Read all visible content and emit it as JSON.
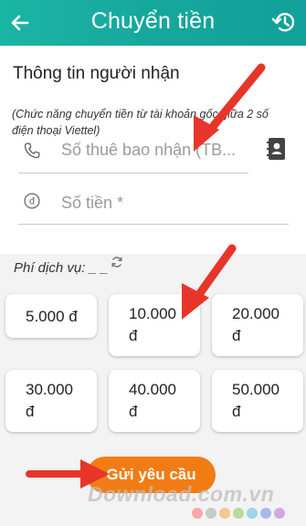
{
  "header": {
    "title": "Chuyển tiền",
    "back_icon": "arrow-left-icon",
    "history_icon": "history-icon"
  },
  "recipient": {
    "section_title": "Thông tin người nhận",
    "note": "(Chức năng chuyển tiền từ tài khoản gốc giữa 2 số điện thoại Viettel)",
    "phone_placeholder": "Số thuê bao nhận (TB...",
    "amount_placeholder": "Số tiền *"
  },
  "fee": {
    "label": "Phí dịch vụ: _ _"
  },
  "amounts": [
    {
      "value": "5.000 đ"
    },
    {
      "value": "10.000 đ"
    },
    {
      "value": "20.000 đ"
    },
    {
      "value": "30.000 đ"
    },
    {
      "value": "40.000 đ"
    },
    {
      "value": "50.000 đ"
    }
  ],
  "submit": {
    "label": "Gửi yêu cầu"
  },
  "watermark": {
    "text": "Download.com.vn"
  },
  "colors": {
    "header": "#16a79c",
    "accent": "#f27c14",
    "arrow": "#e8352a"
  }
}
